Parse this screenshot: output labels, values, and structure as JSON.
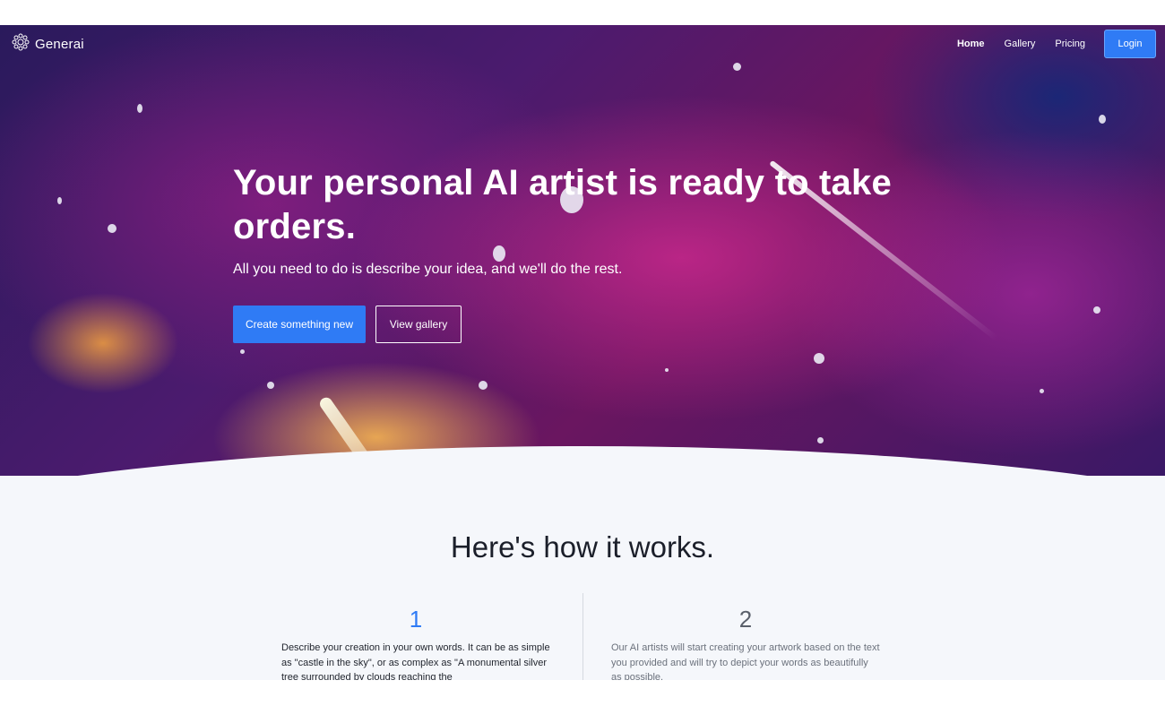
{
  "brand": {
    "name": "Generai",
    "icon": "sparkle-ring-icon"
  },
  "nav": {
    "links": [
      {
        "label": "Home",
        "active": true
      },
      {
        "label": "Gallery",
        "active": false
      },
      {
        "label": "Pricing",
        "active": false
      }
    ],
    "login_label": "Login"
  },
  "hero": {
    "title": "Your personal AI artist is ready to take orders.",
    "subtitle": "All you need to do is describe your idea, and we'll do the rest.",
    "primary_button": "Create something new",
    "secondary_button": "View gallery"
  },
  "how": {
    "title": "Here's how it works.",
    "steps": [
      {
        "number": "1",
        "text": "Describe your creation in your own words. It can be as simple as \"castle in the sky\", or as complex as \"A monumental silver tree surrounded by clouds reaching the"
      },
      {
        "number": "2",
        "text": "Our AI artists will start creating your artwork based on the text you provided and will try to depict your words as beautifully as possible."
      }
    ]
  },
  "colors": {
    "accent": "#2f7bf5",
    "background": "#f5f7fb",
    "heading": "#1b1f2a"
  }
}
